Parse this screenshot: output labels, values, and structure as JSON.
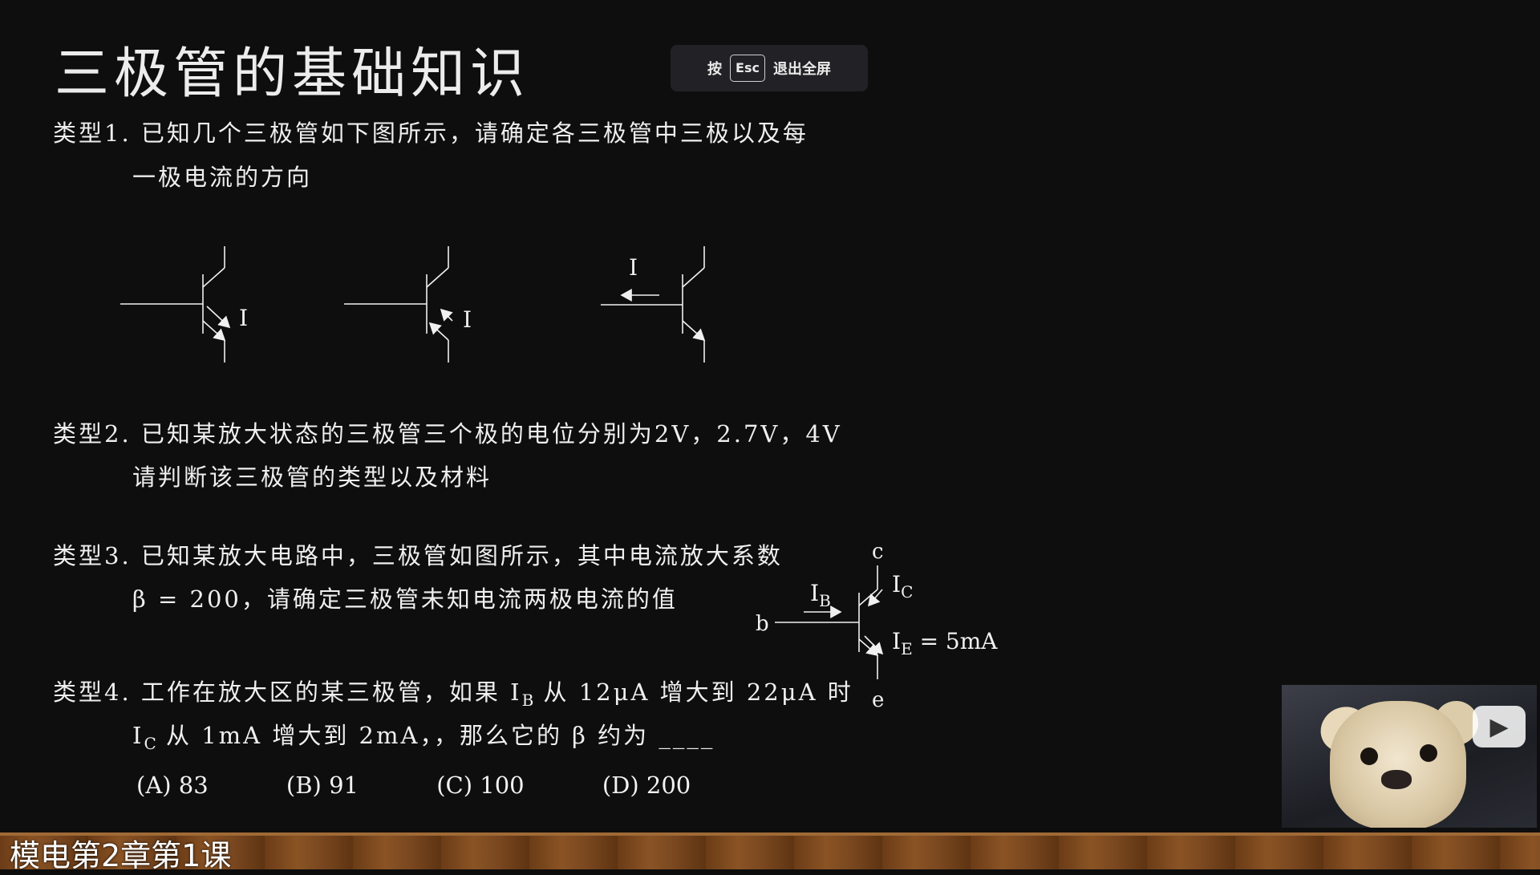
{
  "slide": {
    "title": "三极管的基础知识",
    "fullscreen_hint": {
      "prefix": "按",
      "key": "Esc",
      "suffix": "退出全屏"
    }
  },
  "questions": {
    "q1": {
      "line1": "类型1. 已知几个三极管如下图所示，请确定各三极管中三极以及每",
      "line2": "一极电流的方向"
    },
    "q2": {
      "line1": "类型2. 已知某放大状态的三极管三个极的电位分别为2V，2.7V，4V",
      "line2": "请判断该三极管的类型以及材料"
    },
    "q3": {
      "line1": "类型3. 已知某放大电路中，三极管如图所示，其中电流放大系数",
      "line2": "β = 200，请确定三极管未知电流两极电流的值"
    },
    "q4": {
      "line1_a": "类型4. 工作在放大区的某三极管，如果 I",
      "line1_sub": "B",
      "line1_b": " 从 12μA 增大到 22μA 时",
      "line2_a": "I",
      "line2_sub": "C",
      "line2_b": " 从 1mA 增大到 2mA，，那么它的 β 约为 ____",
      "options": [
        "(A) 83",
        "(B) 91",
        "(C) 100",
        "(D) 200"
      ]
    }
  },
  "diagrams": {
    "transistor_current_label": "I",
    "q3_circuit": {
      "collector": "c",
      "base": "b",
      "emitter": "e",
      "ib": "I",
      "ib_sub": "B",
      "ic": "I",
      "ic_sub": "C",
      "ie": "I",
      "ie_sub": "E",
      "ie_value": " = 5mA"
    }
  },
  "footer": {
    "course_title": "模电第2章第1课"
  },
  "colors": {
    "background": "#0e0e0e",
    "text": "#f0f0f0",
    "wood": "#7a4820"
  },
  "icons": {
    "pip_play": "play-icon"
  }
}
